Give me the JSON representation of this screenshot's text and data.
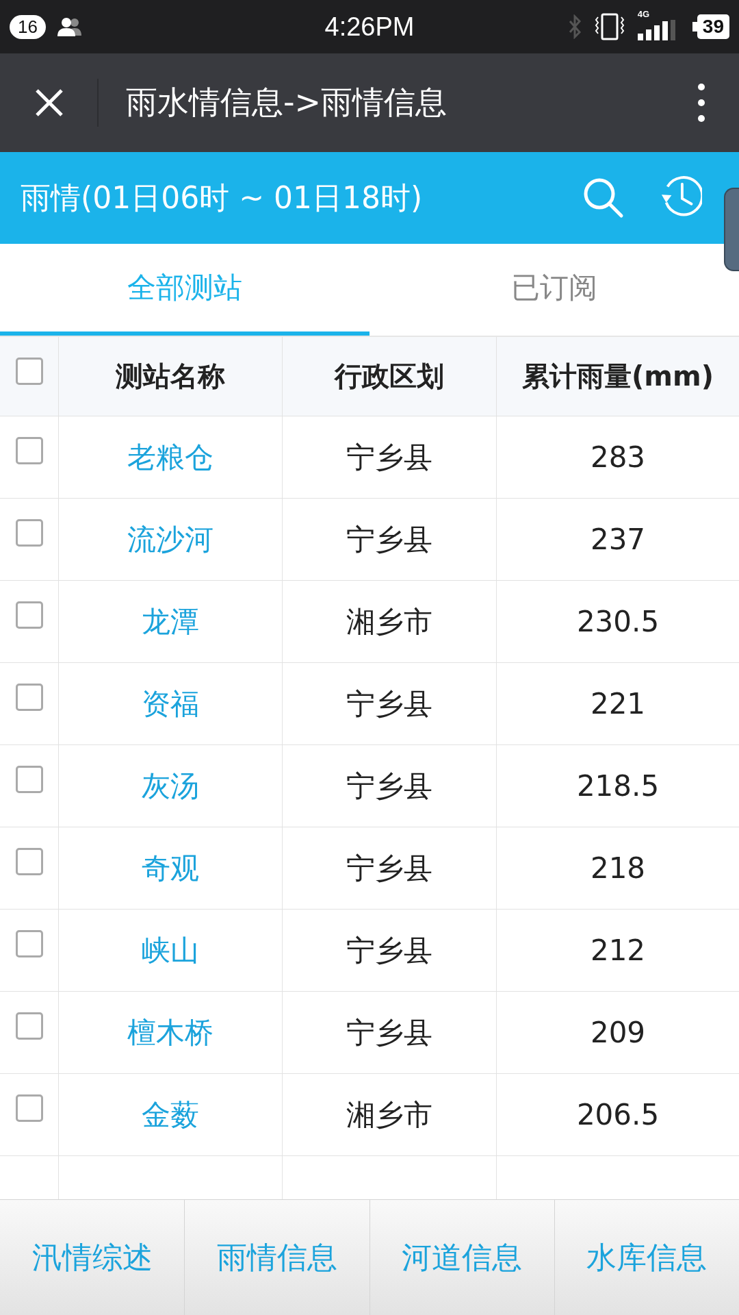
{
  "status_bar": {
    "notification_count": "16",
    "time": "4:26PM",
    "network": "4G",
    "battery": "39"
  },
  "title_bar": {
    "title": "雨水情信息->雨情信息"
  },
  "header": {
    "title": "雨情(01日06时 ~ 01日18时)"
  },
  "tabs": [
    {
      "label": "全部测站",
      "selected": true
    },
    {
      "label": "已订阅",
      "selected": false
    }
  ],
  "table": {
    "select_all_checked": false,
    "columns": [
      "测站名称",
      "行政区划",
      "累计雨量(mm)"
    ],
    "rows": [
      {
        "checked": false,
        "name": "老粮仓",
        "district": "宁乡县",
        "rainfall": "283"
      },
      {
        "checked": false,
        "name": "流沙河",
        "district": "宁乡县",
        "rainfall": "237"
      },
      {
        "checked": false,
        "name": "龙潭",
        "district": "湘乡市",
        "rainfall": "230.5"
      },
      {
        "checked": false,
        "name": "资福",
        "district": "宁乡县",
        "rainfall": "221"
      },
      {
        "checked": false,
        "name": "灰汤",
        "district": "宁乡县",
        "rainfall": "218.5"
      },
      {
        "checked": false,
        "name": "奇观",
        "district": "宁乡县",
        "rainfall": "218"
      },
      {
        "checked": false,
        "name": "峡山",
        "district": "宁乡县",
        "rainfall": "212"
      },
      {
        "checked": false,
        "name": "檀木桥",
        "district": "宁乡县",
        "rainfall": "209"
      },
      {
        "checked": false,
        "name": "金薮",
        "district": "湘乡市",
        "rainfall": "206.5"
      }
    ]
  },
  "bottom_nav": [
    "汛情综述",
    "雨情信息",
    "河道信息",
    "水库信息"
  ]
}
